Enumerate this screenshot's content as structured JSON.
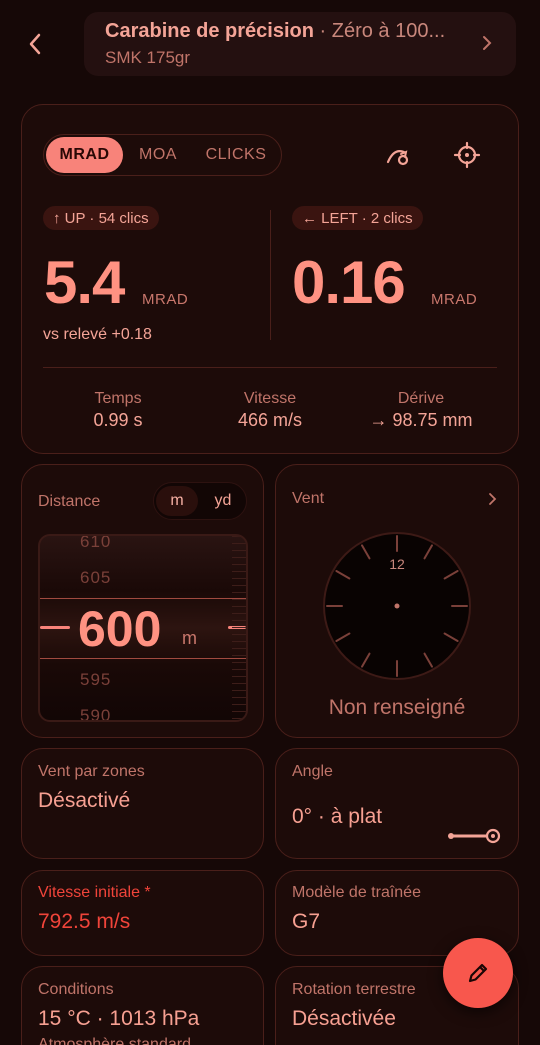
{
  "header": {
    "title": "Carabine de précision",
    "title_suffix": " · Zéro à 100...",
    "subtitle": "SMK 175gr"
  },
  "units": {
    "options": [
      "MRAD",
      "MOA",
      "CLICKS"
    ],
    "selected": "MRAD"
  },
  "elevation": {
    "pill": "↑ UP · 54 clics",
    "value": "5.4",
    "unit": "MRAD",
    "note": "vs relevé +0.18"
  },
  "windage": {
    "pill": "← LEFT · 2 clics",
    "value": "0.16",
    "unit": "MRAD"
  },
  "stats": [
    {
      "label": "Temps",
      "value": "0.99 s"
    },
    {
      "label": "Vitesse",
      "value": "466 m/s"
    },
    {
      "label": "Dérive",
      "value": "→ 98.75 mm"
    }
  ],
  "distance": {
    "label": "Distance",
    "unit_options": [
      "m",
      "yd"
    ],
    "selected_unit": "m",
    "value": "600",
    "unit": "m",
    "ticks": [
      "610",
      "605",
      "595",
      "590"
    ]
  },
  "wind": {
    "label": "Vent",
    "clock_label": "12",
    "status": "Non renseigné"
  },
  "wind_zones": {
    "label": "Vent par zones",
    "value": "Désactivé"
  },
  "angle": {
    "label": "Angle",
    "value": "0° · à plat"
  },
  "muzzle_velocity": {
    "label": "Vitesse initiale *",
    "value": "792.5 m/s"
  },
  "drag_model": {
    "label": "Modèle de traînée",
    "value": "G7"
  },
  "conditions": {
    "label": "Conditions",
    "value": "15 °C · 1013 hPa",
    "sub": "Atmosphère standard"
  },
  "earth_rotation": {
    "label": "Rotation terrestre",
    "value": "Désactivée"
  },
  "colors": {
    "accent": "#f8837a",
    "fab": "#f8574d",
    "background": "#160807",
    "error": "#f0443a"
  }
}
